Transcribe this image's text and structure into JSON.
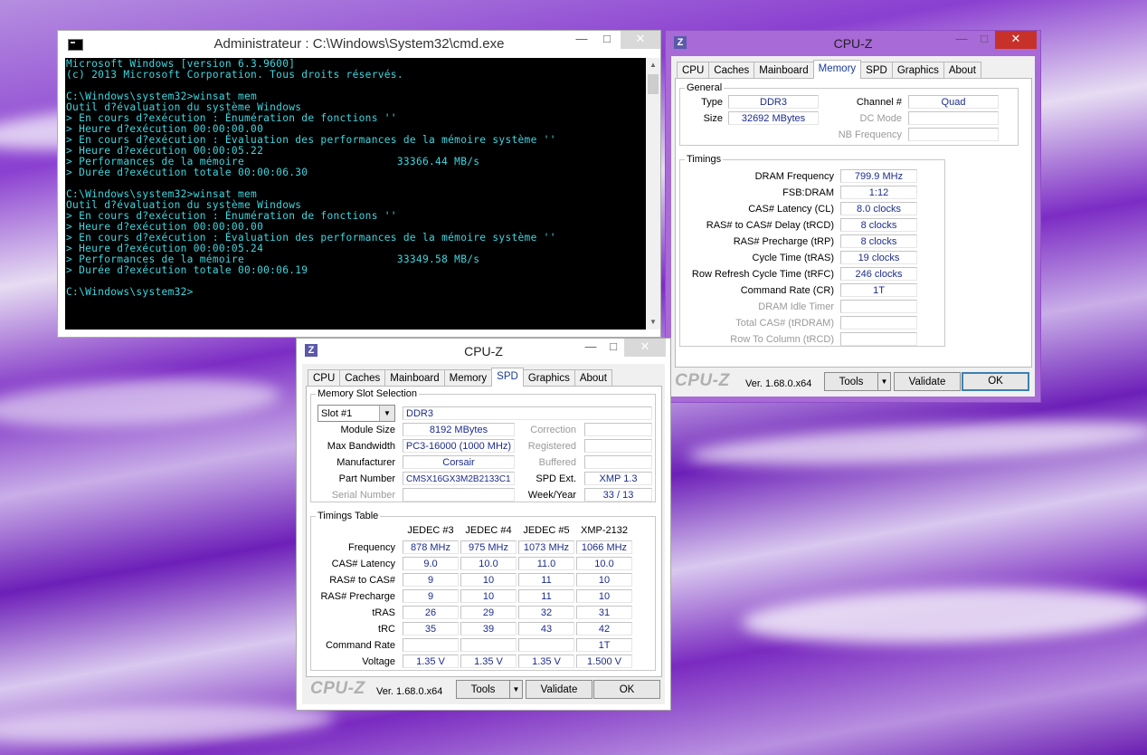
{
  "cmd": {
    "title": "Administrateur : C:\\Windows\\System32\\cmd.exe",
    "lines": [
      "Microsoft Windows [version 6.3.9600]",
      "(c) 2013 Microsoft Corporation. Tous droits réservés.",
      "",
      "C:\\Windows\\system32>winsat mem",
      "Outil d?évaluation du système Windows",
      "> En cours d?exécution : Énumération de fonctions ''",
      "> Heure d?exécution 00:00:00.00",
      "> En cours d?exécution : Évaluation des performances de la mémoire système ''",
      "> Heure d?exécution 00:00:05.22",
      "> Performances de la mémoire                        33366.44 MB/s",
      "> Durée d?exécution totale 00:00:06.30",
      "",
      "C:\\Windows\\system32>winsat mem",
      "Outil d?évaluation du système Windows",
      "> En cours d?exécution : Énumération de fonctions ''",
      "> Heure d?exécution 00:00:00.00",
      "> En cours d?exécution : Évaluation des performances de la mémoire système ''",
      "> Heure d?exécution 00:00:05.24",
      "> Performances de la mémoire                        33349.58 MB/s",
      "> Durée d?exécution totale 00:00:06.19",
      "",
      "C:\\Windows\\system32>"
    ]
  },
  "cpuz_mem": {
    "title": "CPU-Z",
    "tabs": [
      "CPU",
      "Caches",
      "Mainboard",
      "Memory",
      "SPD",
      "Graphics",
      "About"
    ],
    "active_tab": "Memory",
    "general_legend": "General",
    "type_label": "Type",
    "type": "DDR3",
    "size_label": "Size",
    "size": "32692 MBytes",
    "channel_label": "Channel #",
    "channel": "Quad",
    "dc_label": "DC Mode",
    "dc": "",
    "nb_label": "NB Frequency",
    "nb": "",
    "timings_legend": "Timings",
    "timings": [
      {
        "label": "DRAM Frequency",
        "value": "799.9 MHz",
        "dim": false
      },
      {
        "label": "FSB:DRAM",
        "value": "1:12",
        "dim": false
      },
      {
        "label": "CAS# Latency (CL)",
        "value": "8.0 clocks",
        "dim": false
      },
      {
        "label": "RAS# to CAS# Delay (tRCD)",
        "value": "8 clocks",
        "dim": false
      },
      {
        "label": "RAS# Precharge (tRP)",
        "value": "8 clocks",
        "dim": false
      },
      {
        "label": "Cycle Time (tRAS)",
        "value": "19 clocks",
        "dim": false
      },
      {
        "label": "Row Refresh Cycle Time (tRFC)",
        "value": "246 clocks",
        "dim": false
      },
      {
        "label": "Command Rate (CR)",
        "value": "1T",
        "dim": false
      },
      {
        "label": "DRAM Idle Timer",
        "value": "",
        "dim": true
      },
      {
        "label": "Total CAS# (tRDRAM)",
        "value": "",
        "dim": true
      },
      {
        "label": "Row To Column (tRCD)",
        "value": "",
        "dim": true
      }
    ],
    "brand": "CPU-Z",
    "version": "Ver. 1.68.0.x64",
    "tools": "Tools",
    "validate": "Validate",
    "ok": "OK"
  },
  "cpuz_spd": {
    "title": "CPU-Z",
    "tabs": [
      "CPU",
      "Caches",
      "Mainboard",
      "Memory",
      "SPD",
      "Graphics",
      "About"
    ],
    "active_tab": "SPD",
    "slot_legend": "Memory Slot Selection",
    "slot": "Slot #1",
    "slot_type": "DDR3",
    "module_size_label": "Module Size",
    "module_size": "8192 MBytes",
    "max_bw_label": "Max Bandwidth",
    "max_bw": "PC3-16000 (1000 MHz)",
    "manufacturer_label": "Manufacturer",
    "manufacturer": "Corsair",
    "part_label": "Part Number",
    "part": "CMSX16GX3M2B2133C1",
    "serial_label": "Serial Number",
    "serial": "",
    "correction_label": "Correction",
    "correction": "",
    "registered_label": "Registered",
    "registered": "",
    "buffered_label": "Buffered",
    "buffered": "",
    "spdext_label": "SPD Ext.",
    "spdext": "XMP 1.3",
    "week_label": "Week/Year",
    "week": "33 / 13",
    "timings_legend": "Timings Table",
    "columns": [
      "JEDEC #3",
      "JEDEC #4",
      "JEDEC #5",
      "XMP-2132"
    ],
    "rows": [
      {
        "label": "Frequency",
        "values": [
          "878 MHz",
          "975 MHz",
          "1073 MHz",
          "1066 MHz"
        ]
      },
      {
        "label": "CAS# Latency",
        "values": [
          "9.0",
          "10.0",
          "11.0",
          "10.0"
        ]
      },
      {
        "label": "RAS# to CAS#",
        "values": [
          "9",
          "10",
          "11",
          "10"
        ]
      },
      {
        "label": "RAS# Precharge",
        "values": [
          "9",
          "10",
          "11",
          "10"
        ]
      },
      {
        "label": "tRAS",
        "values": [
          "26",
          "29",
          "32",
          "31"
        ]
      },
      {
        "label": "tRC",
        "values": [
          "35",
          "39",
          "43",
          "42"
        ]
      },
      {
        "label": "Command Rate",
        "values": [
          "",
          "",
          "",
          "1T"
        ]
      },
      {
        "label": "Voltage",
        "values": [
          "1.35 V",
          "1.35 V",
          "1.35 V",
          "1.500 V"
        ]
      }
    ],
    "brand": "CPU-Z",
    "version": "Ver. 1.68.0.x64",
    "tools": "Tools",
    "validate": "Validate",
    "ok": "OK"
  },
  "colors": {
    "accent_border": "#9b59d6",
    "close": "#c7312a",
    "console_text": "#3fd6e0"
  }
}
